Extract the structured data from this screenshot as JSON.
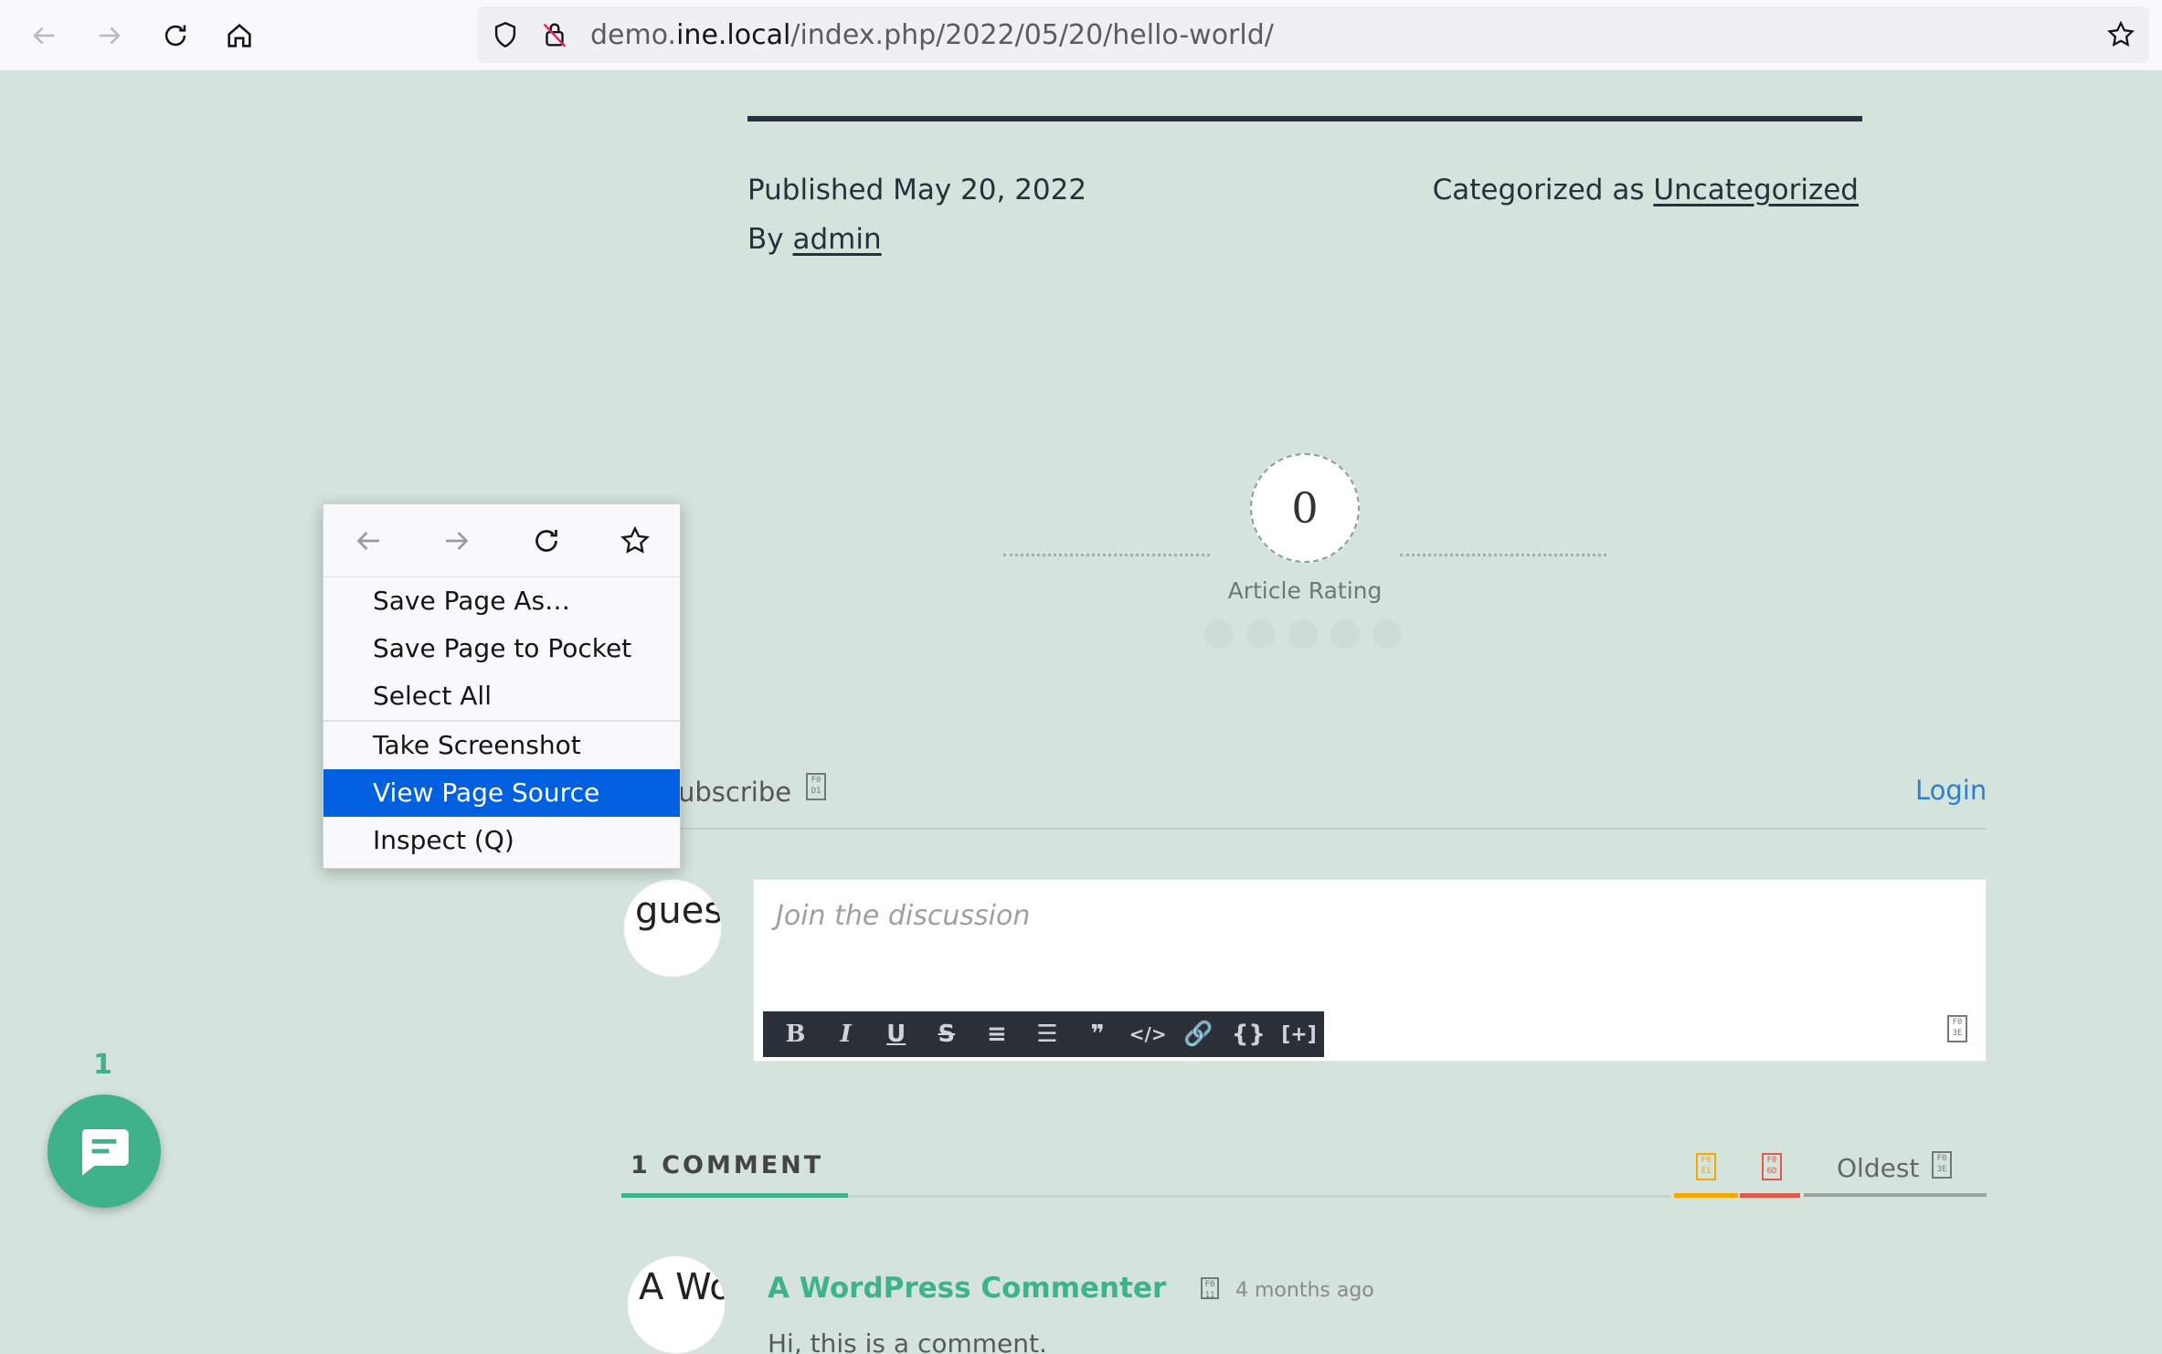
{
  "browser": {
    "url_prefix": "demo.",
    "url_domain": "ine.local",
    "url_path": "/index.php/2022/05/20/hello-world/"
  },
  "post_meta": {
    "published": "Published May 20, 2022",
    "by_prefix": "By",
    "author": "admin",
    "categorized_prefix": "Categorized as",
    "category": "Uncategorized"
  },
  "rating": {
    "value": "0",
    "label": "Article Rating",
    "stars_filled": 0,
    "stars_total": 5
  },
  "discussion": {
    "subscribe": "ubscribe",
    "login": "Login",
    "guest_avatar_text": "gues",
    "placeholder": "Join the discussion",
    "editor_buttons": [
      "B",
      "I",
      "U",
      "S",
      "OL",
      "UL",
      "❞",
      "</>",
      "link",
      "{}",
      "[+]"
    ]
  },
  "comments": {
    "count_label": "1 COMMENT",
    "sort_label": "Oldest",
    "author_avatar_text": "A Wor",
    "author": "A WordPress Commenter",
    "time_ago": "4 months ago",
    "text": "Hi, this is a comment."
  },
  "chat": {
    "badge": "1"
  },
  "context_menu": {
    "items": [
      "Save Page As…",
      "Save Page to Pocket",
      "Select All",
      "Take Screenshot",
      "View Page Source",
      "Inspect (Q)"
    ],
    "active_index": 4
  },
  "colors": {
    "page_bg": "#d4e3dc",
    "accent": "#3fb28b",
    "menu_highlight": "#0060df",
    "link_blue": "#2e7fd0",
    "sort_orange": "#f4a900",
    "sort_red": "#e05a4a"
  }
}
